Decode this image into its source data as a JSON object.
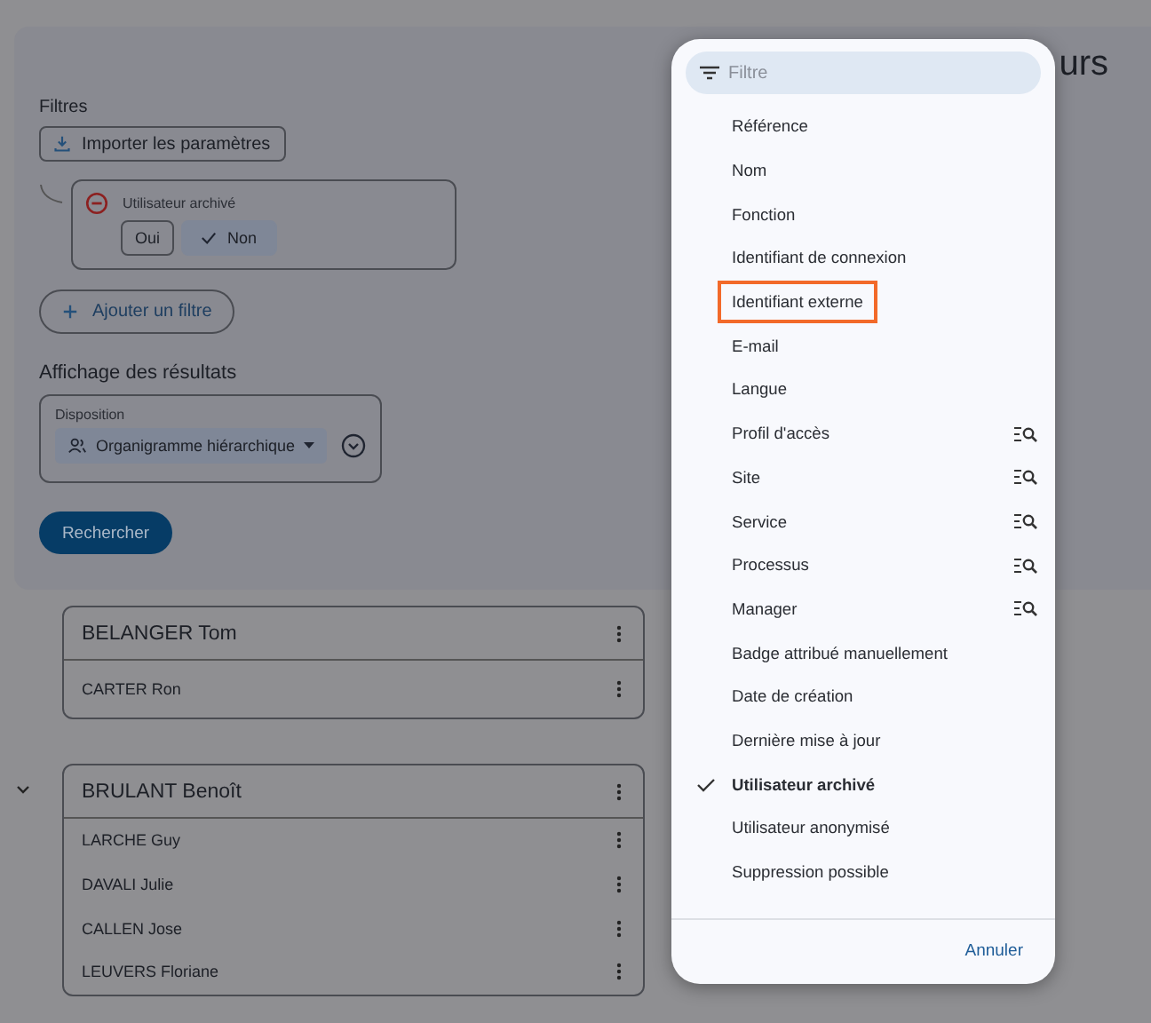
{
  "page_title": "urs",
  "filters": {
    "heading": "Filtres",
    "import_button": "Importer les paramètres",
    "filter": {
      "label": "Utilisateur archivé",
      "options": [
        {
          "label": "Oui",
          "selected": false
        },
        {
          "label": "Non",
          "selected": true
        }
      ]
    },
    "add_button": "Ajouter un filtre"
  },
  "display": {
    "heading": "Affichage des résultats",
    "label": "Disposition",
    "value": "Organigramme hiérarchique"
  },
  "search_button": "Rechercher",
  "groups": [
    {
      "name": "BELANGER Tom",
      "expandable": false,
      "members": [
        "CARTER Ron"
      ]
    },
    {
      "name": "BRULANT Benoît",
      "expandable": true,
      "members": [
        "LARCHE Guy",
        "DAVALI Julie",
        "CALLEN Jose",
        "LEUVERS Floriane"
      ]
    }
  ],
  "menu": {
    "search_placeholder": "Filtre",
    "items": [
      {
        "label": "Référence",
        "checked": false,
        "searchable": false,
        "highlighted": false
      },
      {
        "label": "Nom",
        "checked": false,
        "searchable": false,
        "highlighted": false
      },
      {
        "label": "Fonction",
        "checked": false,
        "searchable": false,
        "highlighted": false
      },
      {
        "label": "Identifiant de connexion",
        "checked": false,
        "searchable": false,
        "highlighted": false
      },
      {
        "label": "Identifiant externe",
        "checked": false,
        "searchable": false,
        "highlighted": true
      },
      {
        "label": "E-mail",
        "checked": false,
        "searchable": false,
        "highlighted": false
      },
      {
        "label": "Langue",
        "checked": false,
        "searchable": false,
        "highlighted": false
      },
      {
        "label": "Profil d'accès",
        "checked": false,
        "searchable": true,
        "highlighted": false
      },
      {
        "label": "Site",
        "checked": false,
        "searchable": true,
        "highlighted": false
      },
      {
        "label": "Service",
        "checked": false,
        "searchable": true,
        "highlighted": false
      },
      {
        "label": "Processus",
        "checked": false,
        "searchable": true,
        "highlighted": false
      },
      {
        "label": "Manager",
        "checked": false,
        "searchable": true,
        "highlighted": false
      },
      {
        "label": "Badge attribué manuellement",
        "checked": false,
        "searchable": false,
        "highlighted": false
      },
      {
        "label": "Date de création",
        "checked": false,
        "searchable": false,
        "highlighted": false
      },
      {
        "label": "Dernière mise à jour",
        "checked": false,
        "searchable": false,
        "highlighted": false
      },
      {
        "label": "Utilisateur archivé",
        "checked": true,
        "searchable": false,
        "highlighted": false
      },
      {
        "label": "Utilisateur anonymisé",
        "checked": false,
        "searchable": false,
        "highlighted": false
      },
      {
        "label": "Suppression possible",
        "checked": false,
        "searchable": false,
        "highlighted": false
      }
    ],
    "cancel_button": "Annuler"
  }
}
